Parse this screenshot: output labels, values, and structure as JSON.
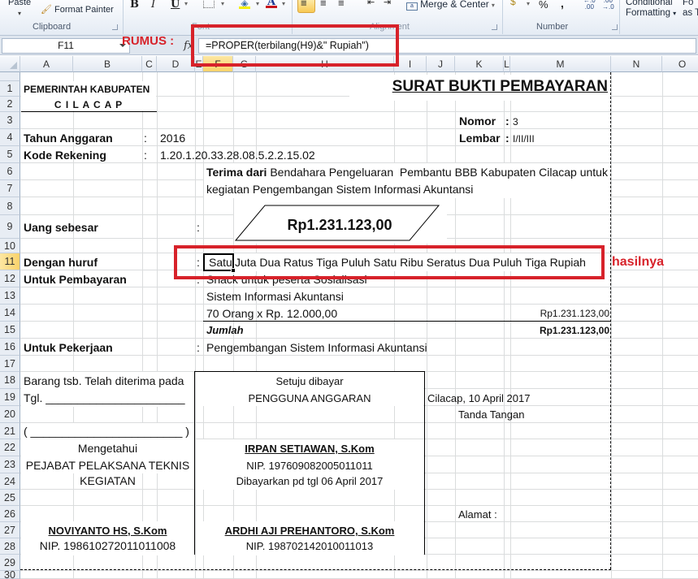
{
  "ribbon": {
    "paste_label": "Paste",
    "format_painter_label": "Format Painter",
    "clipboard_group": "Clipboard",
    "bold": "B",
    "italic": "I",
    "underline": "U",
    "font_color_glyph": "A",
    "font_group": "Font",
    "merge_center_label": "Merge & Center",
    "alignment_group": "Alignment",
    "percent": "%",
    "comma": ",",
    "number_group": "Number",
    "conditional_formatting_line1": "Conditional",
    "conditional_formatting_line2": "Formatting",
    "format_as_table_line1": "Fo",
    "format_as_table_line2": "as T"
  },
  "formula_bar": {
    "name_box": "F11",
    "fx": "fx",
    "formula": "=PROPER(terbilang(H9)&\" Rupiah\")"
  },
  "annotations": {
    "rumus": "RUMUS :",
    "hasilnya": "hasilnya",
    "color": "#d7222a"
  },
  "columns": [
    "A",
    "B",
    "C",
    "D",
    "E",
    "F",
    "G",
    "H",
    "I",
    "J",
    "K",
    "L",
    "M",
    "N",
    "O"
  ],
  "selected_column": "F",
  "rows": [
    "1",
    "2",
    "3",
    "4",
    "5",
    "6",
    "7",
    "8",
    "9",
    "10",
    "11",
    "12",
    "13",
    "14",
    "15",
    "16",
    "17",
    "18",
    "19",
    "20",
    "21",
    "22",
    "23",
    "24",
    "25",
    "26",
    "27",
    "28",
    "29",
    "30"
  ],
  "selected_row": "11",
  "sheet": {
    "pemerintah": "PEMERINTAH KABUPATEN",
    "cilacap": "C I L A C A P",
    "title": "SURAT BUKTI PEMBAYARAN",
    "nomor_label": "Nomor",
    "nomor_colon": ":",
    "nomor_value": "3",
    "lembar_label": "Lembar",
    "lembar_colon": ":",
    "lembar_value": "I/II/III",
    "tahun_label": "Tahun Anggaran",
    "tahun_colon": ":",
    "tahun_value": "2016",
    "kode_label": "Kode Rekening",
    "kode_colon": ":",
    "kode_value": "1.20.1.20.33.28.08.5.2.2.15.02",
    "terima_bold": "Terima dari",
    "terima_rest": " Bendahara Pengeluaran  Pembantu BBB Kabupaten Cilacap untuk",
    "terima_line2": "kegiatan Pengembangan Sistem Informasi Akuntansi",
    "uang_label": "Uang sebesar",
    "uang_colon": ":",
    "uang_value": "Rp1.231.123,00",
    "huruf_label": "Dengan huruf",
    "huruf_colon": ":",
    "huruf_active_cell": "Satu",
    "huruf_rest": "Juta Dua Ratus Tiga Puluh Satu Ribu Seratus Dua Puluh Tiga Rupiah",
    "pembayaran_label": "Untuk Pembayaran",
    "pembayaran_colon": ":",
    "pembayaran_line1": "Snack untuk peserta Sosialisasi",
    "pembayaran_line2": "Sistem Informasi Akuntansi",
    "pembayaran_line3": "70 Orang x Rp. 12.000,00",
    "pembayaran_amount": "Rp1.231.123,00",
    "jumlah_label": "Jumlah",
    "jumlah_value": "Rp1.231.123,00",
    "pekerjaan_label": "Untuk Pekerjaan",
    "pekerjaan_colon": ":",
    "pekerjaan_value": "Pengembangan Sistem Informasi Akuntansi",
    "barang": "Barang tsb. Telah diterima pada",
    "tgl": "Tgl. ______________________",
    "paren_line": "( ________________________ )",
    "mengetahui": "Mengetahui",
    "pejabat": "PEJABAT PELAKSANA TEKNIS",
    "kegiatan": "KEGIATAN",
    "noviyanto": "NOVIYANTO HS, S.Kom",
    "nip_noviyanto": "NIP. 198610272011011008",
    "setuju": "Setuju dibayar",
    "pengguna": "PENGGUNA ANGGARAN",
    "irpan": "IRPAN SETIAWAN, S.Kom",
    "nip_irpan": "NIP. 197609082005011011",
    "dibayarkan": "Dibayarkan pd tgl 06 April 2017",
    "ardhi": "ARDHI AJI PREHANTORO, S.Kom",
    "nip_ardhi": "NIP. 198702142010011013",
    "cilacap_date": "Cilacap, 10 April 2017",
    "tanda_tangan": "Tanda Tangan",
    "alamat": "Alamat :"
  }
}
